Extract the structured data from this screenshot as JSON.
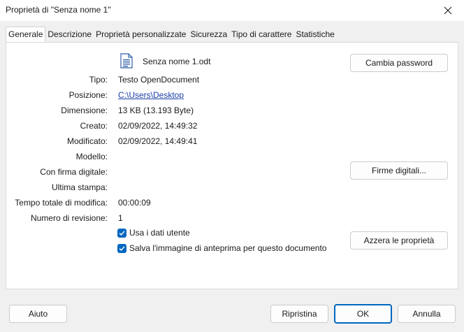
{
  "window": {
    "title": "Proprietà di \"Senza nome 1\""
  },
  "tabs": [
    {
      "label": "Generale",
      "active": true
    },
    {
      "label": "Descrizione",
      "active": false
    },
    {
      "label": "Proprietà personalizzate",
      "active": false
    },
    {
      "label": "Sicurezza",
      "active": false
    },
    {
      "label": "Tipo di carattere",
      "active": false
    },
    {
      "label": "Statistiche",
      "active": false
    }
  ],
  "document": {
    "icon": "document-icon",
    "name": "Senza nome 1.odt"
  },
  "properties": {
    "tipo": {
      "label": "Tipo:",
      "value": "Testo OpenDocument"
    },
    "posizione": {
      "label": "Posizione:",
      "value": "C:\\Users\\Desktop"
    },
    "dimensione": {
      "label": "Dimensione:",
      "value": "13 KB (13.193 Byte)"
    },
    "creato": {
      "label": "Creato:",
      "value": "02/09/2022, 14:49:32"
    },
    "modificato": {
      "label": "Modificato:",
      "value": "02/09/2022, 14:49:41"
    },
    "modello": {
      "label": "Modello:",
      "value": ""
    },
    "firma": {
      "label": "Con firma digitale:",
      "value": ""
    },
    "stampa": {
      "label": "Ultima stampa:",
      "value": ""
    },
    "tempo": {
      "label": "Tempo totale di modifica:",
      "value": "00:00:09"
    },
    "revisione": {
      "label": "Numero di revisione:",
      "value": "1"
    }
  },
  "checkboxes": {
    "usa_dati": {
      "label": "Usa i dati utente",
      "checked": true
    },
    "salva_anteprima": {
      "label": "Salva l'immagine di anteprima per questo documento",
      "checked": true
    }
  },
  "buttons": {
    "cambia_password": "Cambia password",
    "firme_digitali": "Firme digitali...",
    "azzera": "Azzera le proprietà",
    "aiuto": "Aiuto",
    "ripristina": "Ripristina",
    "ok": "OK",
    "annulla": "Annulla"
  },
  "colors": {
    "accent": "#0067c0",
    "link": "#1a3da5"
  }
}
